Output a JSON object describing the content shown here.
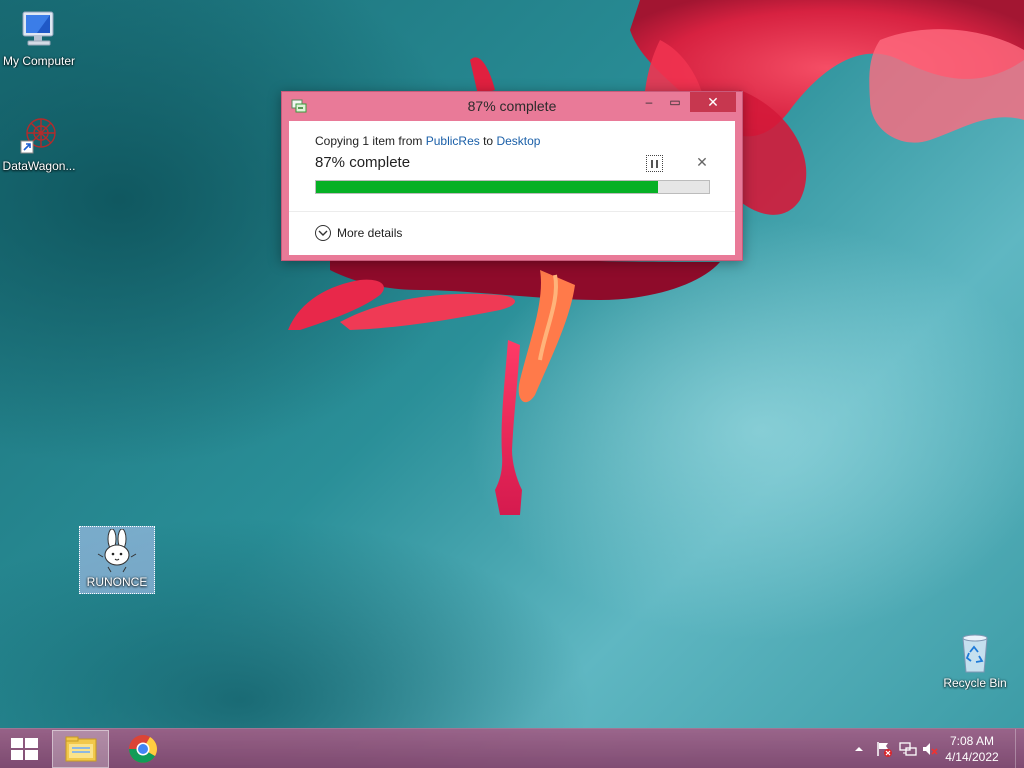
{
  "desktop": {
    "icons": [
      {
        "label": "My Computer",
        "icon": "computer-icon"
      },
      {
        "label": "DataWagon...",
        "icon": "datawagon-shortcut-icon"
      },
      {
        "label": "RUNONCE",
        "icon": "rabbit-icon"
      },
      {
        "label": "Recycle Bin",
        "icon": "recycle-bin-icon"
      }
    ]
  },
  "copy_dialog": {
    "title": "87% complete",
    "copy_prefix": "Copying 1 item from ",
    "source": "PublicRes",
    "to_word": " to ",
    "destination": "Desktop",
    "progress_text": "87% complete",
    "progress_percent": 87,
    "more_details_label": "More details",
    "buttons": {
      "minimize": "minimize-icon",
      "maximize": "maximize-icon",
      "close": "close-icon",
      "pause": "pause-icon",
      "cancel": "cancel-icon"
    }
  },
  "taskbar": {
    "apps": [
      {
        "name": "File Explorer",
        "icon": "file-explorer-icon",
        "active": true
      },
      {
        "name": "Google Chrome",
        "icon": "chrome-icon",
        "active": false
      }
    ],
    "tray": {
      "icons": [
        "show-hidden-icons-icon",
        "action-center-flag-icon",
        "network-icon",
        "volume-muted-icon"
      ],
      "time": "7:08 AM",
      "date": "4/14/2022"
    }
  },
  "colors": {
    "dialog_frame": "#e97a98",
    "close_button": "#c7374f",
    "progress_fill": "#06b025",
    "link": "#1a5fa8",
    "taskbar": "#9a5a84"
  }
}
